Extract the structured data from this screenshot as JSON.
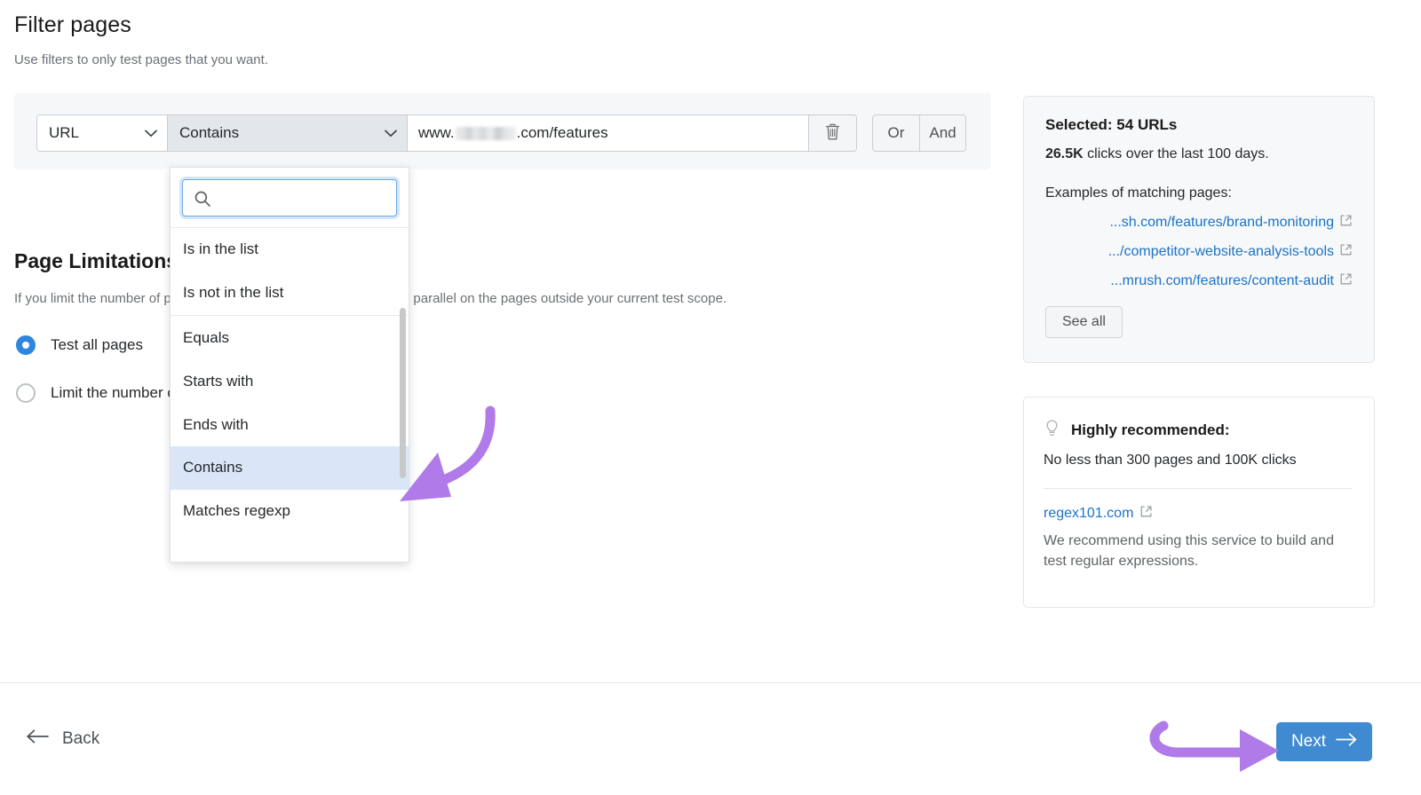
{
  "header": {
    "title": "Filter pages",
    "subtitle": "Use filters to only test pages that you want."
  },
  "filter": {
    "field_select": "URL",
    "operator_select": "Contains",
    "url_prefix": "www.",
    "url_suffix": ".com/features",
    "url_value": "www.██████.com/features",
    "delete_icon": "trash-icon",
    "or_label": "Or",
    "and_label": "And"
  },
  "dropdown": {
    "search_placeholder": "",
    "search_value": "",
    "search_icon": "search-icon",
    "groups": [
      {
        "items": [
          "Is in the list",
          "Is not in the list"
        ]
      },
      {
        "items": [
          "Equals",
          "Starts with",
          "Ends with",
          "Contains",
          "Matches regexp"
        ]
      }
    ],
    "selected": "Contains"
  },
  "page_limitations": {
    "title": "Page Limitations",
    "description": "If you limit the number of pages, you can run another experiment in parallel on the pages outside your current test scope.",
    "options": [
      {
        "label": "Test all pages",
        "selected": true
      },
      {
        "label": "Limit the number of pages",
        "selected": false
      }
    ]
  },
  "selected_panel": {
    "title": "Selected: 54 URLs",
    "clicks_value": "26.5K",
    "clicks_text": "clicks over the last 100 days.",
    "examples_label": "Examples of matching pages:",
    "examples": [
      "...sh.com/features/brand-monitoring",
      ".../competitor-website-analysis-tools",
      "...mrush.com/features/content-audit"
    ],
    "see_all_label": "See all",
    "external_icon": "external-link-icon"
  },
  "recommend_panel": {
    "bulb_icon": "lightbulb-icon",
    "title": "Highly recommended:",
    "note": "No less than 300 pages and 100K clicks",
    "link_label": "regex101.com",
    "link_icon": "external-link-icon",
    "description": "We recommend using this service to build and test regular expressions."
  },
  "footer": {
    "back_label": "Back",
    "back_icon": "arrow-left-icon",
    "next_label": "Next",
    "next_icon": "arrow-right-icon"
  },
  "colors": {
    "accent_blue": "#3f8ad1",
    "link_blue": "#1a73c7",
    "annotation_purple": "#b07ae8",
    "highlight_row": "#d9e6f7"
  }
}
